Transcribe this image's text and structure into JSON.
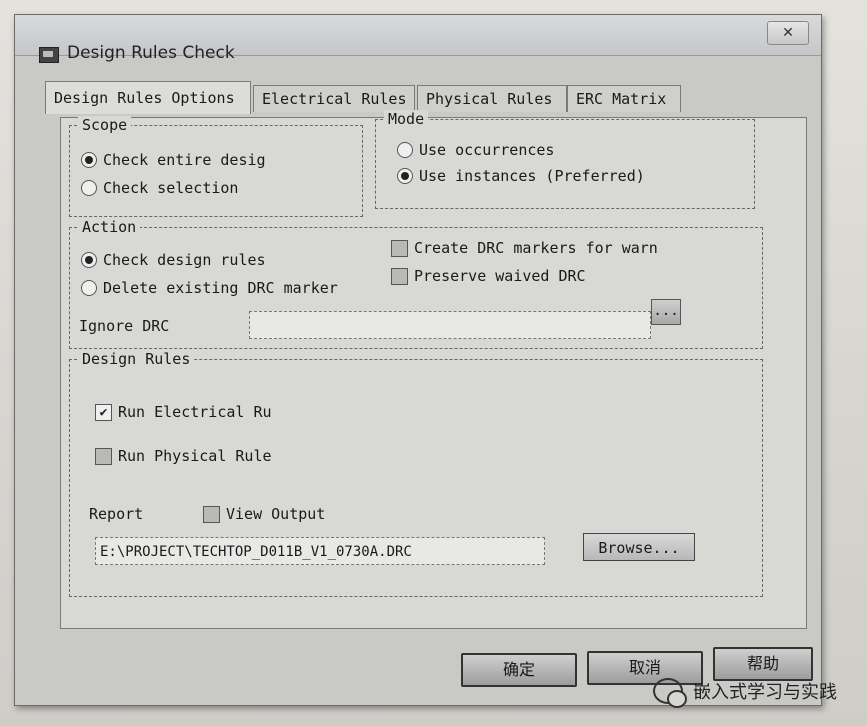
{
  "window": {
    "title": "Design Rules Check",
    "close_label": "✕"
  },
  "tabs": [
    {
      "label": "Design Rules Options",
      "active": true
    },
    {
      "label": "Electrical Rules",
      "active": false
    },
    {
      "label": "Physical Rules",
      "active": false
    },
    {
      "label": "ERC Matrix",
      "active": false
    }
  ],
  "scope": {
    "label": "Scope",
    "options": [
      {
        "label": "Check entire desig",
        "selected": true
      },
      {
        "label": "Check selection",
        "selected": false
      }
    ]
  },
  "mode": {
    "label": "Mode",
    "options": [
      {
        "label": "Use occurrences",
        "selected": false
      },
      {
        "label": "Use instances (Preferred)",
        "selected": true
      }
    ]
  },
  "action": {
    "label": "Action",
    "radios": [
      {
        "label": "Check design rules",
        "selected": true
      },
      {
        "label": "Delete existing DRC marker",
        "selected": false
      }
    ],
    "checks": [
      {
        "label": "Create DRC markers for warn",
        "checked": false
      },
      {
        "label": "Preserve waived DRC",
        "checked": false
      }
    ],
    "ignore_label": "Ignore DRC",
    "ignore_value": "",
    "browse_dots": "..."
  },
  "design_rules": {
    "label": "Design Rules",
    "run_electrical": {
      "label": "Run Electrical Ru",
      "checked": true
    },
    "run_physical": {
      "label": "Run Physical Rule",
      "checked": false
    },
    "report_label": "Report",
    "view_output": {
      "label": "View Output",
      "checked": false
    },
    "report_path": "E:\\PROJECT\\TECHTOP_D011B_V1_0730A.DRC",
    "browse_label": "Browse..."
  },
  "buttons": {
    "ok": "确定",
    "cancel": "取消",
    "help": "帮助"
  },
  "watermark": {
    "text": "嵌入式学习与实践",
    "icon": "wechat-icon"
  },
  "check_mark": "✔"
}
